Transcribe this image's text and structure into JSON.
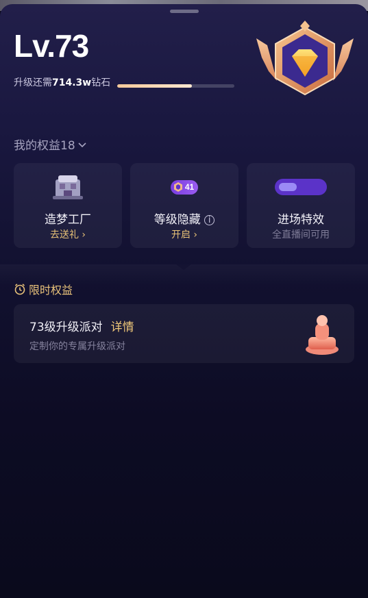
{
  "header": {
    "level": "Lv.73",
    "upgrade_prefix": "升级还需",
    "upgrade_amount": "714.3w",
    "upgrade_suffix": "钻石",
    "progress": 0.64
  },
  "rights": {
    "title": "我的权益18",
    "cards": [
      {
        "name": "造梦工厂",
        "action": "去送礼",
        "icon": "dream-factory-icon"
      },
      {
        "name": "等级隐藏",
        "action": "开启",
        "badge_number": "41",
        "icon": "level-badge-icon"
      },
      {
        "name": "进场特效",
        "action": "全直播间可用",
        "icon": "entrance-effect-icon"
      }
    ]
  },
  "limited": {
    "title": "限时权益",
    "party": {
      "title": "73级升级派对",
      "link": "详情",
      "desc": "定制你的专属升级派对"
    }
  },
  "colors": {
    "accent_gold": "#e8c277",
    "background": "#0b0a1e",
    "purple": "#5b33c8"
  }
}
